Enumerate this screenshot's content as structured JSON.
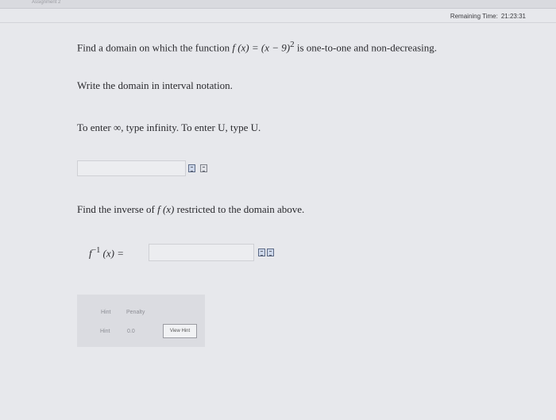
{
  "header": {
    "tab_label": "Assignment 2",
    "remaining_label": "Remaining Time:",
    "remaining_value": "21:23:31"
  },
  "question1": {
    "prompt_before": "Find a domain on which the function ",
    "function_lhs": "f (x) = ",
    "function_rhs_base": "(x − 9)",
    "function_exponent": "2",
    "prompt_after": " is one-to-one and non-decreasing.",
    "instruction": "Write the domain in interval notation.",
    "enter_prefix": "To enter ",
    "infinity_symbol": "∞",
    "enter_middle": ", type infinity. To enter ",
    "union_symbol": "U",
    "enter_suffix": ", type U.",
    "answer_value": ""
  },
  "question2": {
    "prompt_before": "Find the inverse of ",
    "function_ref": "f (x)",
    "prompt_after": " restricted to the domain above.",
    "label_f": "f",
    "label_sup": "−1",
    "label_rest": " (x) =",
    "answer_value": ""
  },
  "hint_panel": {
    "col_hint": "Hint",
    "col_penalty": "Penalty",
    "row_hint": "Hint",
    "row_penalty": "0.0",
    "view_hint_label": "View Hint"
  }
}
